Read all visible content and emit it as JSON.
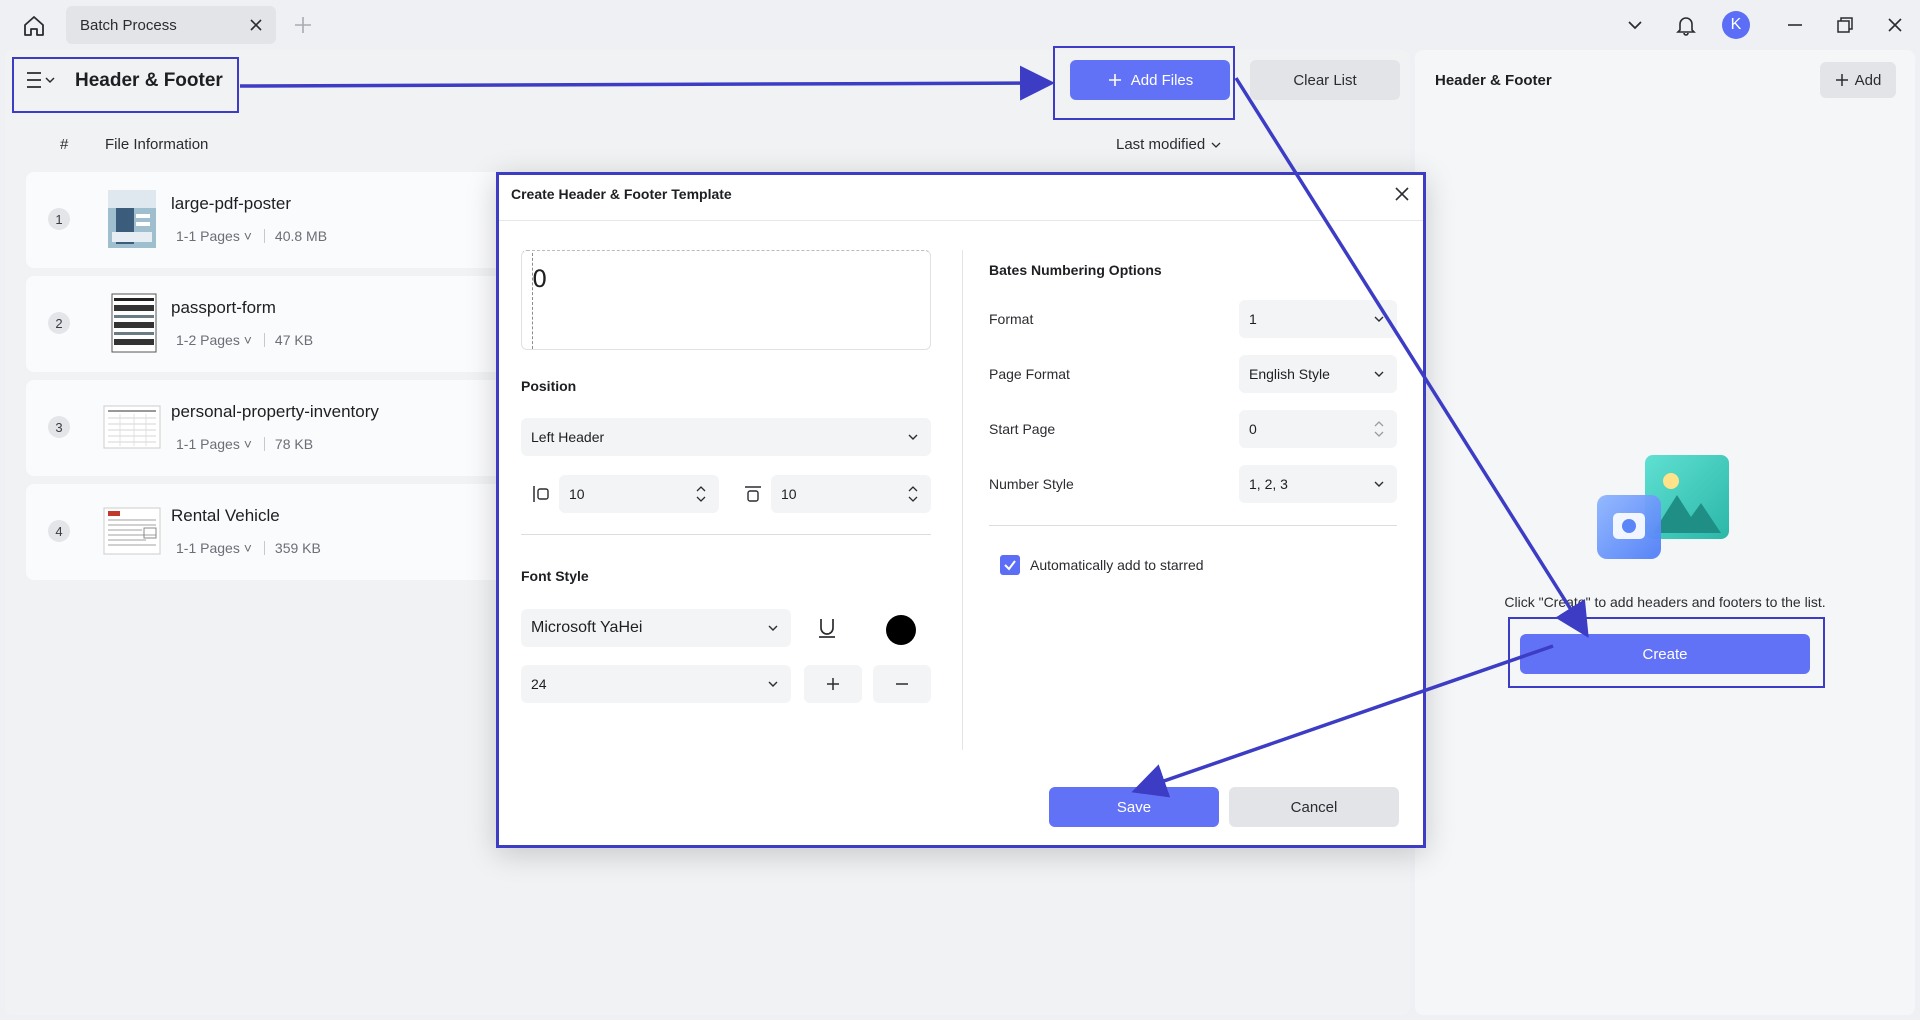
{
  "titlebar": {
    "tab_label": "Batch Process",
    "avatar_letter": "K"
  },
  "left": {
    "title": "Header & Footer",
    "add_files": "Add Files",
    "clear_list": "Clear List",
    "col_number": "#",
    "col_file": "File Information",
    "sort_label": "Last modified",
    "files": [
      {
        "index": "1",
        "name": "large-pdf-poster",
        "pages": "1-1 Pages",
        "size": "40.8 MB"
      },
      {
        "index": "2",
        "name": "passport-form",
        "pages": "1-2 Pages",
        "size": "47 KB"
      },
      {
        "index": "3",
        "name": "personal-property-inventory",
        "pages": "1-1 Pages",
        "size": "78 KB"
      },
      {
        "index": "4",
        "name": "Rental Vehicle",
        "pages": "1-1 Pages",
        "size": "359 KB"
      }
    ]
  },
  "right": {
    "title": "Header & Footer",
    "add_label": "Add",
    "hint": "Click \"Create\" to add headers and footers to the list.",
    "create_label": "Create"
  },
  "dialog": {
    "title": "Create Header & Footer Template",
    "preview_text": "0",
    "position_label": "Position",
    "position_value": "Left Header",
    "margin_left": "10",
    "margin_top": "10",
    "font_style_label": "Font Style",
    "font_family": "Microsoft YaHei",
    "font_size": "24",
    "text_color": "#000000",
    "bates_label": "Bates Numbering Options",
    "format_label": "Format",
    "format_value": "1",
    "page_format_label": "Page Format",
    "page_format_value": "English Style",
    "start_page_label": "Start Page",
    "start_page_value": "0",
    "number_style_label": "Number Style",
    "number_style_value": "1, 2, 3",
    "auto_star_label": "Automatically add to starred",
    "auto_star_checked": true,
    "save_label": "Save",
    "cancel_label": "Cancel"
  },
  "colors": {
    "accent": "#6272f6",
    "annotation": "#3c3cc4"
  }
}
